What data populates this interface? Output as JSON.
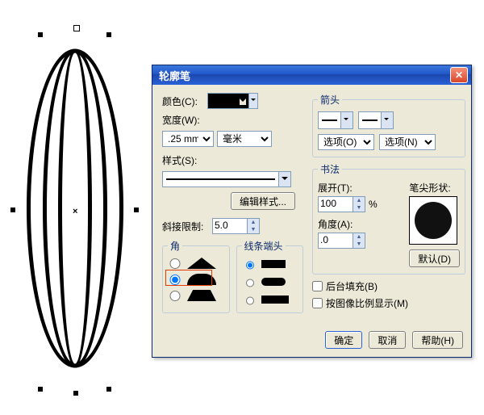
{
  "dialog": {
    "title": "轮廓笔",
    "color_label": "颜色(C):",
    "width_label": "宽度(W):",
    "width_value": ".25 mm",
    "width_unit": "毫米",
    "style_label": "样式(S):",
    "edit_style_btn": "编辑样式...",
    "miter_label": "斜接限制:",
    "miter_value": "5.0",
    "corners_legend": "角",
    "caps_legend": "线条端头",
    "arrows_legend": "箭头",
    "options_left": "选项(O)",
    "options_right": "选项(N)",
    "callig_legend": "书法",
    "stretch_label": "展开(T):",
    "stretch_value": "100",
    "stretch_pct": "%",
    "angle_label": "角度(A):",
    "angle_value": ".0",
    "nib_label": "笔尖形状:",
    "default_btn": "默认(D)",
    "behind_fill": "后台填充(B)",
    "scale_with_image": "按图像比例显示(M)",
    "ok": "确定",
    "cancel": "取消",
    "help": "帮助(H)"
  }
}
